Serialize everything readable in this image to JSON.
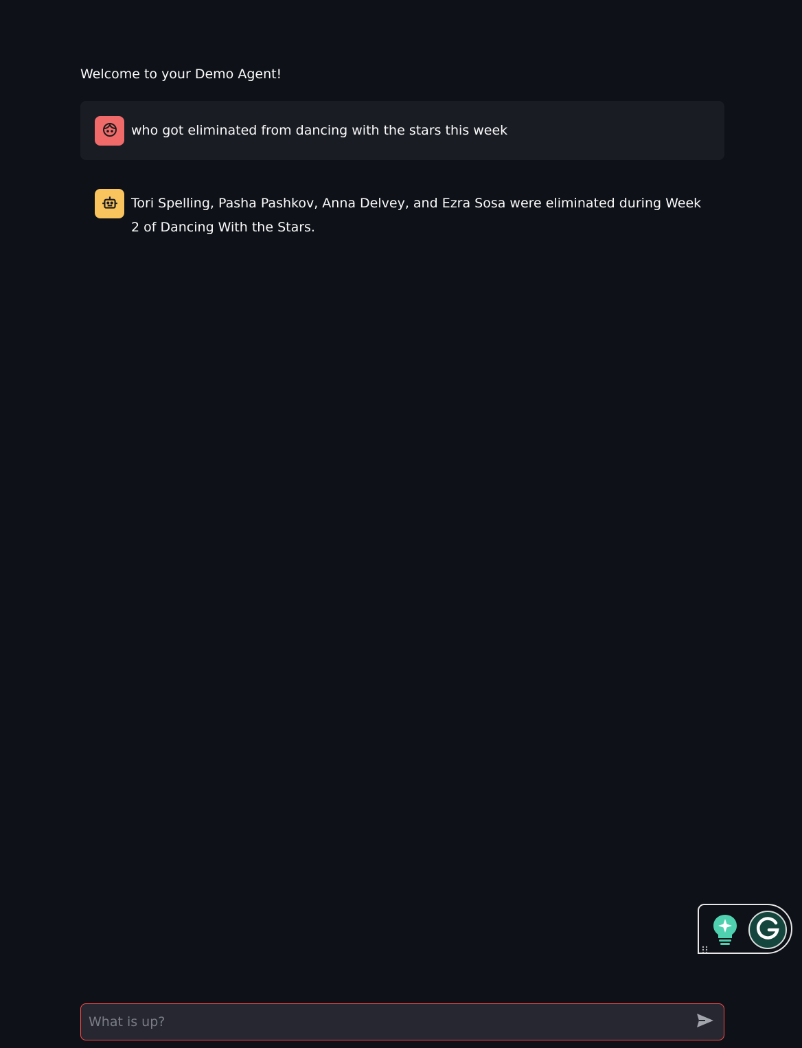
{
  "page": {
    "welcome_text": "Welcome to your Demo Agent!"
  },
  "messages": [
    {
      "role": "user",
      "avatar_icon": "user-face-icon",
      "text": "who got eliminated from dancing with the stars this week"
    },
    {
      "role": "assistant",
      "avatar_icon": "robot-icon",
      "text": "Tori Spelling, Pasha Pashkov, Anna Delvey, and Ezra Sosa were eliminated during Week 2 of Dancing With the Stars."
    }
  ],
  "chat_input": {
    "placeholder": "What is up?",
    "value": "",
    "send_icon": "send-icon"
  },
  "grammarly_widget": {
    "icons": [
      "drag-grip-icon",
      "lightbulb-sparkle-icon",
      "grammarly-g-icon"
    ]
  },
  "colors": {
    "background": "#0e1117",
    "user_bubble": "#1a1c24",
    "user_avatar": "#f06a6a",
    "assistant_avatar": "#f9c35e",
    "input_border_focus": "#ff4b4b",
    "input_background": "#262730",
    "grammarly_green": "#15463d",
    "grammarly_bulb": "#4fd1b0"
  }
}
